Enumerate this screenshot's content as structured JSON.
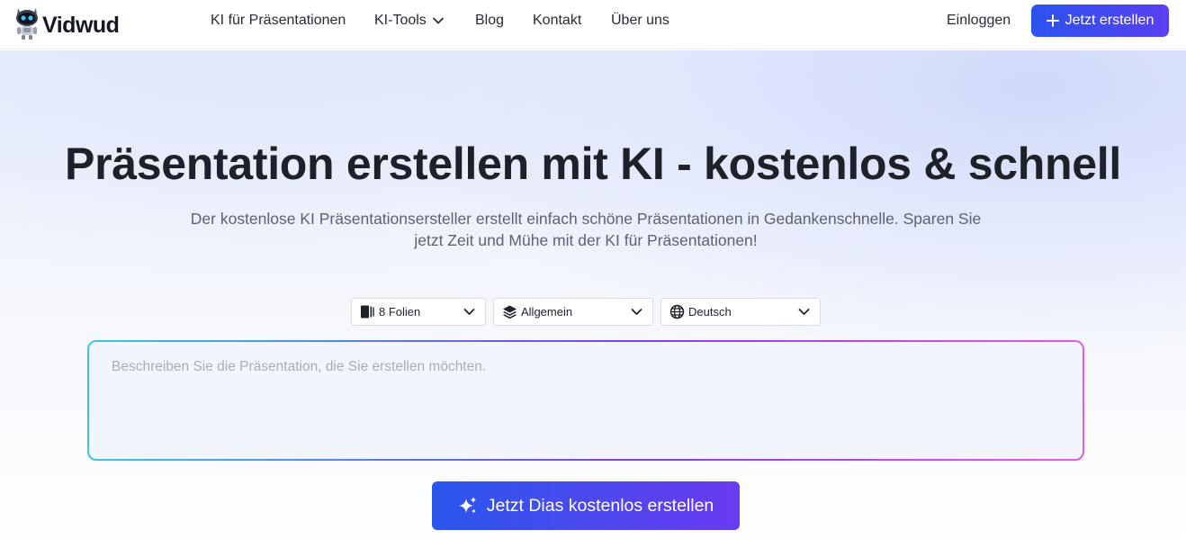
{
  "brand": {
    "name": "Vidwud"
  },
  "nav": {
    "links": [
      "KI für Präsentationen",
      "KI-Tools",
      "Blog",
      "Kontakt",
      "Über uns"
    ],
    "login": "Einloggen",
    "cta": "Jetzt erstellen"
  },
  "hero": {
    "title": "Präsentation erstellen mit KI - kostenlos & schnell",
    "subtitle": "Der kostenlose KI Präsentationsersteller erstellt einfach schöne Präsentationen in Gedankenschnelle. Sparen Sie jetzt Zeit und Mühe mit der KI für Präsentationen!"
  },
  "options": {
    "slides": {
      "value": "8 Folien",
      "icon": "slides-icon"
    },
    "style": {
      "value": "Allgemein",
      "icon": "layers-icon"
    },
    "language": {
      "value": "Deutsch",
      "icon": "globe-icon"
    }
  },
  "prompt": {
    "placeholder": "Beschreiben Sie die Präsentation, die Sie erstellen möchten.",
    "value": ""
  },
  "generate": {
    "label": "Jetzt Dias kostenlos erstellen",
    "icon": "sparkle-icon"
  },
  "colors": {
    "primary": "#2a54ef",
    "primary_end": "#6a3bf1",
    "border_gradient": [
      "#39c6e4",
      "#7d3ff0",
      "#e65be8"
    ]
  }
}
